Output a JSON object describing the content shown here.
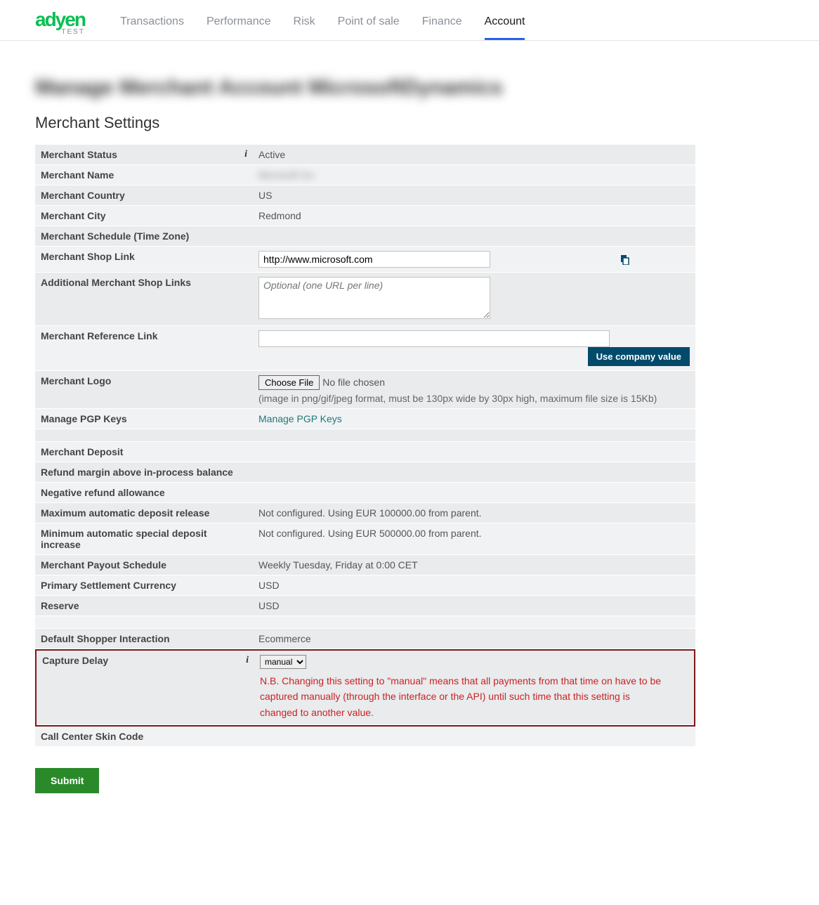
{
  "brand": {
    "name": "adyen",
    "sub": "TEST"
  },
  "nav": {
    "items": [
      {
        "label": "Transactions"
      },
      {
        "label": "Performance"
      },
      {
        "label": "Risk"
      },
      {
        "label": "Point of sale"
      },
      {
        "label": "Finance"
      },
      {
        "label": "Account"
      }
    ],
    "active_index": 5
  },
  "page_title_blurred": "Manage Merchant Account MicrosoftDynamics",
  "section_title": "Merchant Settings",
  "fields": {
    "status": {
      "label": "Merchant Status",
      "value": "Active"
    },
    "name": {
      "label": "Merchant Name",
      "value_blurred": "Microsoft Inc"
    },
    "country": {
      "label": "Merchant Country",
      "value": "US"
    },
    "city": {
      "label": "Merchant City",
      "value": "Redmond"
    },
    "schedule": {
      "label": "Merchant Schedule (Time Zone)",
      "value": ""
    },
    "shop_link": {
      "label": "Merchant Shop Link",
      "value": "http://www.microsoft.com"
    },
    "additional_links": {
      "label": "Additional Merchant Shop Links",
      "placeholder": "Optional (one URL per line)"
    },
    "reference_link": {
      "label": "Merchant Reference Link",
      "value": "",
      "button": "Use company value"
    },
    "logo": {
      "label": "Merchant Logo",
      "button": "Choose File",
      "no_file": "No file chosen",
      "hint": "(image in png/gif/jpeg format, must be 130px wide by 30px high, maximum file size is 15Kb)"
    },
    "pgp": {
      "label": "Manage PGP Keys",
      "link": "Manage PGP Keys"
    },
    "deposit": {
      "label": "Merchant Deposit",
      "value": ""
    },
    "refund_margin": {
      "label": "Refund margin above in-process balance",
      "value": ""
    },
    "negative_refund": {
      "label": "Negative refund allowance",
      "value": ""
    },
    "max_auto_deposit": {
      "label": "Maximum automatic deposit release",
      "value": "Not configured. Using EUR 100000.00 from parent."
    },
    "min_auto_special": {
      "label": "Minimum automatic special deposit increase",
      "value": "Not configured. Using EUR 500000.00 from parent."
    },
    "payout_schedule": {
      "label": "Merchant Payout Schedule",
      "value": "Weekly Tuesday, Friday at 0:00 CET"
    },
    "settlement_currency": {
      "label": "Primary Settlement Currency",
      "value": "USD"
    },
    "reserve": {
      "label": "Reserve",
      "value": "USD"
    },
    "shopper_interaction": {
      "label": "Default Shopper Interaction",
      "value": "Ecommerce"
    },
    "capture_delay": {
      "label": "Capture Delay",
      "selected": "manual",
      "warning": "N.B. Changing this setting to \"manual\" means that all payments from that time on have to be captured manually (through the interface or the API) until such time that this setting is changed to another value."
    },
    "call_center": {
      "label": "Call Center Skin Code",
      "value": ""
    }
  },
  "submit_label": "Submit"
}
